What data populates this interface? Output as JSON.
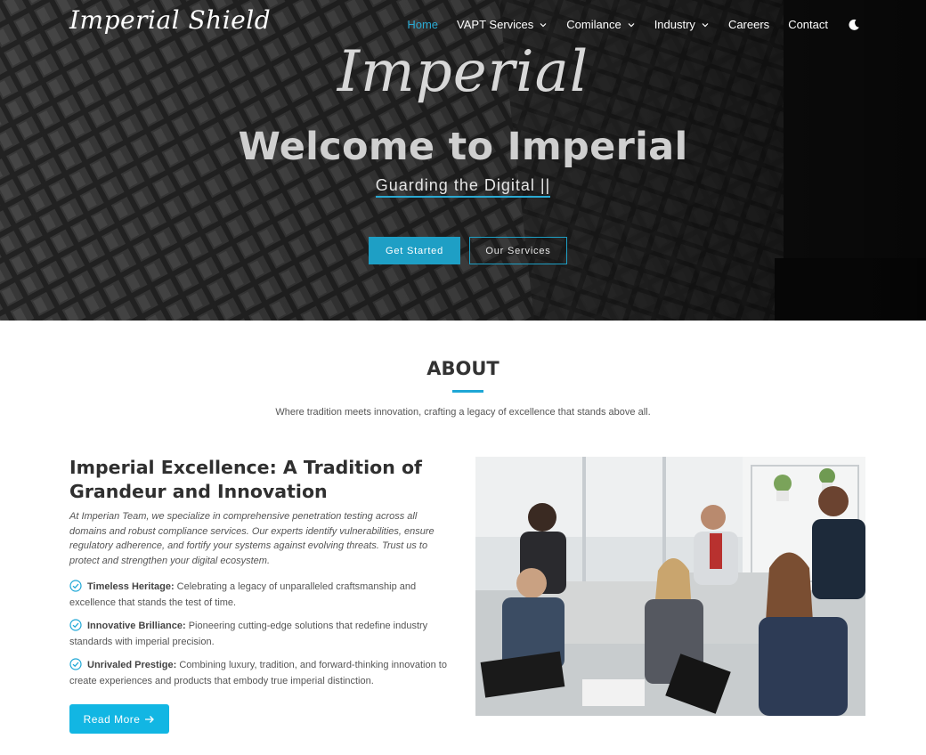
{
  "brand": {
    "logo_text": "Imperial Shield",
    "accent": "#1e9fc5"
  },
  "nav": {
    "items": [
      {
        "label": "Home",
        "active": true,
        "dropdown": false
      },
      {
        "label": "VAPT Services",
        "active": false,
        "dropdown": true
      },
      {
        "label": "Comilance",
        "active": false,
        "dropdown": true
      },
      {
        "label": "Industry",
        "active": false,
        "dropdown": true
      },
      {
        "label": "Careers",
        "active": false,
        "dropdown": false
      },
      {
        "label": "Contact",
        "active": false,
        "dropdown": false
      }
    ],
    "theme_toggle_icon": "moon-icon"
  },
  "hero": {
    "script_title": "Imperial",
    "title": "Welcome to Imperial",
    "typed_text": "Guarding the Digital ||",
    "primary_button": "Get Started",
    "secondary_button": "Our Services"
  },
  "about": {
    "heading": "ABOUT",
    "subtitle": "Where tradition meets innovation, crafting a legacy of excellence that stands above all.",
    "title": "Imperial Excellence: A Tradition of Grandeur and Innovation",
    "description": "At Imperian Team, we specialize in comprehensive penetration testing across all domains and robust compliance services. Our experts identify vulnerabilities, ensure regulatory adherence, and fortify your systems against evolving threats. Trust us to protect and strengthen your digital ecosystem.",
    "features": [
      {
        "title": "Timeless Heritage:",
        "text": " Celebrating a legacy of unparalleled craftsmanship and excellence that stands the test of time.",
        "icon": "check-circle-icon"
      },
      {
        "title": "Innovative Brilliance:",
        "text": " Pioneering cutting-edge solutions that redefine industry standards with imperial precision.",
        "icon": "check-circle-icon"
      },
      {
        "title": "Unrivaled Prestige:",
        "text": " Combining luxury, tradition, and forward-thinking innovation to create experiences and products that embody true imperial distinction.",
        "icon": "check-circle-icon"
      }
    ],
    "read_more": "Read More",
    "image_icon": "team-meeting-photo"
  }
}
